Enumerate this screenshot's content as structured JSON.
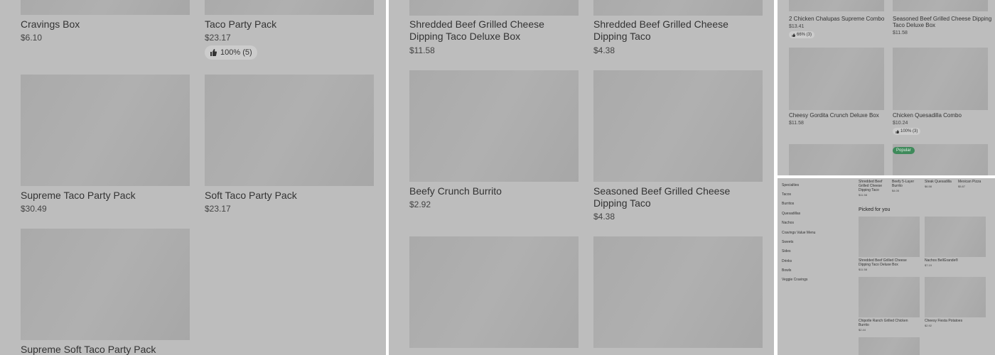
{
  "panelA": {
    "items": [
      {
        "name": "Cravings Box",
        "price": "$6.10"
      },
      {
        "name": "Taco Party Pack",
        "price": "$23.17",
        "rating": "100% (5)"
      },
      {
        "name": "Supreme Taco Party Pack",
        "price": "$30.49"
      },
      {
        "name": "Soft Taco Party Pack",
        "price": "$23.17"
      },
      {
        "name": "Supreme Soft Taco Party Pack",
        "price": ""
      }
    ]
  },
  "panelB": {
    "items": [
      {
        "name": "Shredded Beef Grilled Cheese Dipping Taco Deluxe Box",
        "price": "$11.58"
      },
      {
        "name": "Shredded Beef Grilled Cheese Dipping Taco",
        "price": "$4.38"
      },
      {
        "name": "Beefy Crunch Burrito",
        "price": "$2.92"
      },
      {
        "name": "Seasoned Beef Grilled Cheese Dipping Taco",
        "price": "$4.38"
      }
    ]
  },
  "panelC": {
    "items": [
      {
        "name": "2 Chicken Chalupas Supreme Combo",
        "price": "$13.41",
        "rating": "66% (3)"
      },
      {
        "name": "Seasoned Beef Grilled Cheese Dipping Taco Deluxe Box",
        "price": "$11.58"
      },
      {
        "name": "Cheesy Gordita Crunch Deluxe Box",
        "price": "$11.58"
      },
      {
        "name": "Chicken Quesadilla Combo",
        "price": "$10.24",
        "rating": "100% (3)"
      }
    ],
    "badge": "Popular"
  },
  "panelD": {
    "nav": [
      "Specialties",
      "Tacos",
      "Burritos",
      "Quesadillas",
      "Nachos",
      "Cravings Value Menu",
      "Sweets",
      "Sides",
      "Drinks",
      "Bowls",
      "Veggie Cravings"
    ],
    "top_items": [
      {
        "name": "Shredded Beef Grilled Cheese Dipping Taco",
        "price": "$11.58"
      },
      {
        "name": "Beefy 5-Layer Burrito",
        "price": "$4.05"
      },
      {
        "name": "Steak Quesadilla",
        "price": "$6.58"
      },
      {
        "name": "Mexican Pizza",
        "price": "$5.87"
      }
    ],
    "section_title": "Picked for you",
    "items": [
      {
        "name": "Shredded Beef Grilled Cheese Dipping Taco Deluxe Box",
        "price": "$11.58"
      },
      {
        "name": "Nachos BellGrande®",
        "price": "$7.19"
      },
      {
        "name": "Chipotle Ranch Grilled Chicken Burrito",
        "price": "$2.44"
      },
      {
        "name": "Cheesy Fiesta Potatoes",
        "price": "$2.92"
      }
    ]
  },
  "colors": {
    "overlay": "#bdbdbd",
    "placeholder": "#aaaaaa",
    "badge": "#3f8a5b"
  },
  "icons": {
    "rating": "thumbs-up-icon"
  }
}
